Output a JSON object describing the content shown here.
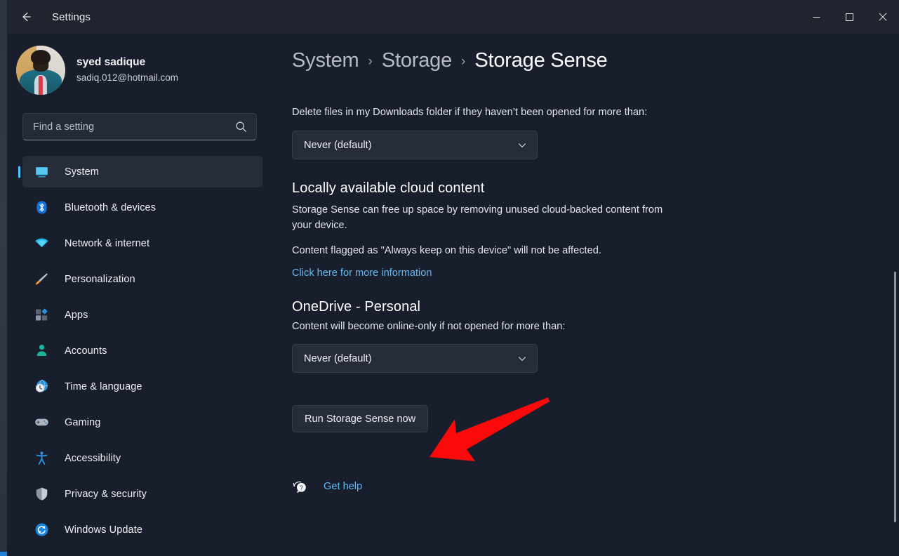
{
  "window": {
    "title": "Settings",
    "back_icon": "back-arrow-icon",
    "minimize_label": "—",
    "maximize_label": "☐",
    "close_label": "✕"
  },
  "account": {
    "name": "syed sadique",
    "email": "sadiq.012@hotmail.com",
    "avatar_icon": "user-avatar-photo"
  },
  "search": {
    "placeholder": "Find a setting",
    "value": "",
    "icon": "search-icon"
  },
  "sidebar": {
    "items": [
      {
        "label": "System",
        "icon": "monitor-icon",
        "selected": true
      },
      {
        "label": "Bluetooth & devices",
        "icon": "bluetooth-icon",
        "selected": false
      },
      {
        "label": "Network & internet",
        "icon": "wifi-icon",
        "selected": false
      },
      {
        "label": "Personalization",
        "icon": "paintbrush-icon",
        "selected": false
      },
      {
        "label": "Apps",
        "icon": "apps-grid-icon",
        "selected": false
      },
      {
        "label": "Accounts",
        "icon": "person-icon",
        "selected": false
      },
      {
        "label": "Time & language",
        "icon": "clock-globe-icon",
        "selected": false
      },
      {
        "label": "Gaming",
        "icon": "gamepad-icon",
        "selected": false
      },
      {
        "label": "Accessibility",
        "icon": "accessibility-icon",
        "selected": false
      },
      {
        "label": "Privacy & security",
        "icon": "shield-icon",
        "selected": false
      },
      {
        "label": "Windows Update",
        "icon": "update-refresh-icon",
        "selected": false
      }
    ]
  },
  "breadcrumb": {
    "items": [
      "System",
      "Storage",
      "Storage Sense"
    ],
    "separator": "›"
  },
  "main": {
    "downloads": {
      "description": "Delete files in my Downloads folder if they haven’t been opened for more than:",
      "dropdown_value": "Never (default)",
      "dropdown_icon": "chevron-down-icon"
    },
    "cloud_content": {
      "heading": "Locally available cloud content",
      "paragraph_1": "Storage Sense can free up space by removing unused cloud-backed content from your device.",
      "paragraph_2": "Content flagged as \"Always keep on this device\" will not be affected.",
      "link": "Click here for more information"
    },
    "onedrive": {
      "heading": "OneDrive - Personal",
      "description": "Content will become online-only if not opened for more than:",
      "dropdown_value": "Never (default)",
      "dropdown_icon": "chevron-down-icon"
    },
    "run_button": "Run Storage Sense now",
    "get_help": {
      "label": "Get help",
      "icon": "help-question-bubble-icon"
    }
  },
  "annotation": {
    "arrow_color": "#fa0a0a",
    "arrow_icon": "red-pointer-arrow"
  },
  "colors": {
    "accent": "#4cc2ff",
    "link": "#63b9f3",
    "sidebar_bg": "#191e2c",
    "surface": "#272c3a",
    "titlebar_bg": "#20242f"
  }
}
